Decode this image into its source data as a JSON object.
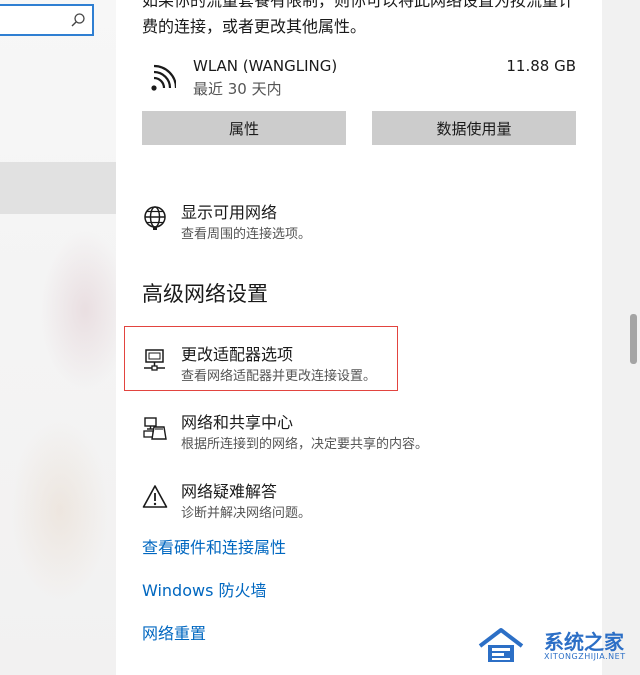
{
  "intro": {
    "line1": "如果你的流量套餐有限制，则你可以将此网络设置为按流量计",
    "line2": "费的连接，或者更改其他属性。"
  },
  "network": {
    "name": "WLAN (WANGLING)",
    "period": "最近 30 天内",
    "usage": "11.88 GB",
    "icon": "wifi-icon"
  },
  "buttons": {
    "properties": "属性",
    "data_usage": "数据使用量"
  },
  "show_networks": {
    "title": "显示可用网络",
    "desc": "查看周围的连接选项。",
    "icon": "globe-icon"
  },
  "advanced": {
    "heading": "高级网络设置",
    "items": [
      {
        "title": "更改适配器选项",
        "desc": "查看网络适配器并更改连接设置。",
        "icon": "monitor-network-icon"
      },
      {
        "title": "网络和共享中心",
        "desc": "根据所连接到的网络，决定要共享的内容。",
        "icon": "sharing-center-icon"
      },
      {
        "title": "网络疑难解答",
        "desc": "诊断并解决网络问题。",
        "icon": "warning-icon"
      }
    ]
  },
  "links": {
    "hardware": "查看硬件和连接属性",
    "firewall": "Windows 防火墙",
    "reset": "网络重置"
  },
  "watermark": {
    "title": "系统之家",
    "subtitle": "XITONGZHIJIA.NET"
  },
  "colors": {
    "accent": "#0067c0",
    "focus_border": "#2f7fd2",
    "highlight": "#e2443f",
    "button_bg": "#cccccc"
  }
}
